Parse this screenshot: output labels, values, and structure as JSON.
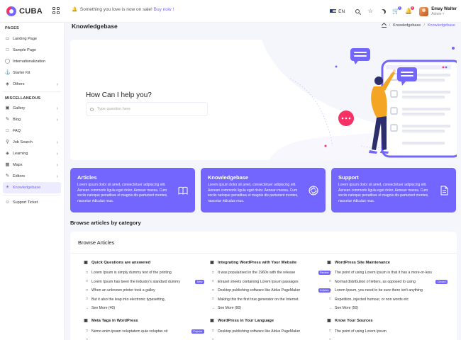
{
  "app": {
    "name": "CUBA"
  },
  "header": {
    "promo_text": "Something you love is now on sale!",
    "promo_link": "Buy now !",
    "language": "EN",
    "notification_count": "4",
    "cart_count": "2",
    "user_name": "Emay Walter",
    "user_role": "Admin"
  },
  "sidebar": {
    "section_pages": "PAGES",
    "pages": [
      {
        "label": "Landing Page",
        "icon": "monitor-icon"
      },
      {
        "label": "Sample Page",
        "icon": "file-icon"
      },
      {
        "label": "Internationalization",
        "icon": "globe-icon"
      },
      {
        "label": "Starter Kit",
        "icon": "anchor-icon"
      },
      {
        "label": "Others",
        "icon": "layers-icon"
      }
    ],
    "section_misc": "MISCELLANEOUS",
    "misc": [
      {
        "label": "Gallery",
        "icon": "image-icon"
      },
      {
        "label": "Blog",
        "icon": "edit-icon"
      },
      {
        "label": "FAQ",
        "icon": "message-icon"
      },
      {
        "label": "Job Search",
        "icon": "search-icon"
      },
      {
        "label": "Learning",
        "icon": "layers-icon"
      },
      {
        "label": "Maps",
        "icon": "map-icon"
      },
      {
        "label": "Editors",
        "icon": "edit-icon"
      },
      {
        "label": "Knowledgebase",
        "icon": "sunrise-icon"
      },
      {
        "label": "Support Ticket",
        "icon": "users-icon"
      }
    ]
  },
  "page": {
    "title": "Knowledgebase",
    "breadcrumb": [
      "Knowledgebase",
      "Knowledgebase"
    ]
  },
  "hero": {
    "question": "How Can I help you?",
    "search_placeholder": "Type question here"
  },
  "feature_cards": [
    {
      "title": "Articles",
      "text": "Lorem ipsum dolor sit amet, consectetuer adipiscing elit. Aenean commodo ligula eget dolor. Aenean massa. Cum sociis natoque penatibus et magnis dis parturient montes, nascetur ridiculus mus.",
      "icon": "book-icon"
    },
    {
      "title": "Knowledgebase",
      "text": "Lorem ipsum dolor sit amet, consectetuer adipiscing elit. Aenean commodo ligula eget dolor. Aenean massa. Cum sociis natoque penatibus et magnis dis parturient montes, nascetur ridiculus mus.",
      "icon": "aperture-icon"
    },
    {
      "title": "Support",
      "text": "Lorem ipsum dolor sit amet, consectetuer adipiscing elit. Aenean commodo ligula eget dolor. Aenean massa. Cum sociis natoque penatibus et magnis dis parturient montes, nascetur ridiculus mus.",
      "icon": "file-text-icon"
    }
  ],
  "category_heading": "Browse articles by category",
  "browse": {
    "title": "Browse Articles",
    "columns": [
      [
        {
          "title": "Quick Questions are answered",
          "items": [
            {
              "text": "Lorem Ipsum is simply dummy text of the printing",
              "tag": ""
            },
            {
              "text": "Lorem Ipsum has been the industry's standard dummy",
              "tag": "New"
            },
            {
              "text": "When an unknown printer took a galley",
              "tag": ""
            },
            {
              "text": "But it also the leap into electronic typesetting,",
              "tag": ""
            }
          ],
          "more": "See More (40)"
        },
        {
          "title": "Meta Tags in WordPress",
          "items": [
            {
              "text": "Nemo enim ipsam voluptatem quia voluptas sit",
              "tag": "Popular"
            },
            {
              "text": "",
              "tag": ""
            }
          ],
          "more": ""
        }
      ],
      [
        {
          "title": "Integrating WordPress with Your Website",
          "items": [
            {
              "text": "It was popularised in the 1960s with the release",
              "tag": "Review"
            },
            {
              "text": "Etraset sheets containing Lorem Ipsum passages",
              "tag": ""
            },
            {
              "text": "Desktop publishing software like Aldus PageMaker",
              "tag": "Articles"
            },
            {
              "text": "Making this the first true generator on the Internet.",
              "tag": ""
            }
          ],
          "more": "See More (90)"
        },
        {
          "title": "WordPress in Your Language",
          "items": [
            {
              "text": "Desktop publishing software like Aldus PageMaker",
              "tag": ""
            },
            {
              "text": "",
              "tag": ""
            }
          ],
          "more": ""
        }
      ],
      [
        {
          "title": "WordPress Site Maintenance",
          "items": [
            {
              "text": "The point of using Lorem Ipsum is that it has a more-or-less",
              "tag": ""
            },
            {
              "text": "Normal distribution of letters, as opposed to using",
              "tag": "Closed"
            },
            {
              "text": "Lorem Ipsum, you need to be sure there isn't anything",
              "tag": ""
            },
            {
              "text": "Repetition, injected humour, or non words etc",
              "tag": ""
            }
          ],
          "more": "See More (50)"
        },
        {
          "title": "Know Your Sources",
          "items": [
            {
              "text": "The point of using Lorem Ipsum",
              "tag": ""
            },
            {
              "text": "",
              "tag": ""
            }
          ],
          "more": ""
        }
      ]
    ]
  },
  "colors": {
    "accent": "#7366ff",
    "secondary": "#f73164"
  }
}
